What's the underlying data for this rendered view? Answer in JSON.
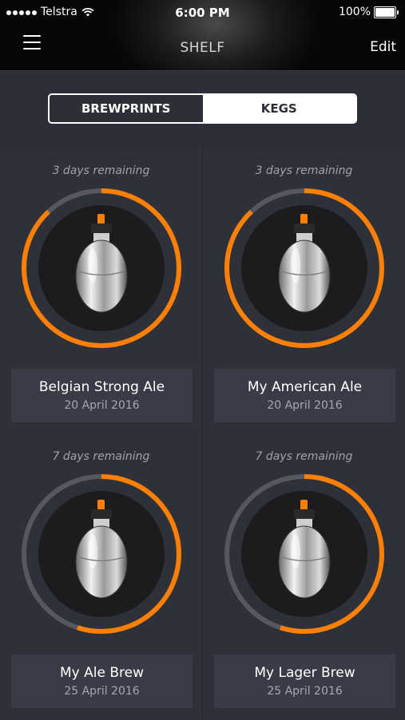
{
  "status_bar": {
    "carrier": "Telstra",
    "time": "6:00 PM",
    "battery": "100%"
  },
  "nav": {
    "title": "SHELF",
    "edit_label": "Edit"
  },
  "tabs": [
    {
      "label": "BREWPRINTS",
      "active": false
    },
    {
      "label": "KEGS",
      "active": true
    }
  ],
  "kegs": [
    {
      "remaining": "3 days remaining",
      "name": "Belgian Strong Ale",
      "date": "20 April 2016",
      "progress": 0.88
    },
    {
      "remaining": "3 days remaining",
      "name": "My American Ale",
      "date": "20 April 2016",
      "progress": 0.88
    },
    {
      "remaining": "7 days remaining",
      "name": "My Ale Brew",
      "date": "25 April 2016",
      "progress": 0.55
    },
    {
      "remaining": "7 days remaining",
      "name": "My Lager Brew",
      "date": "25 April 2016",
      "progress": 0.55
    }
  ],
  "colors": {
    "accent": "#ff7f00",
    "track": "#555861",
    "background": "#2c2f37",
    "card": "#2e313a",
    "label_bg": "#393c46"
  },
  "icons": [
    "menu-icon",
    "wifi-icon",
    "battery-icon",
    "keg-icon"
  ]
}
